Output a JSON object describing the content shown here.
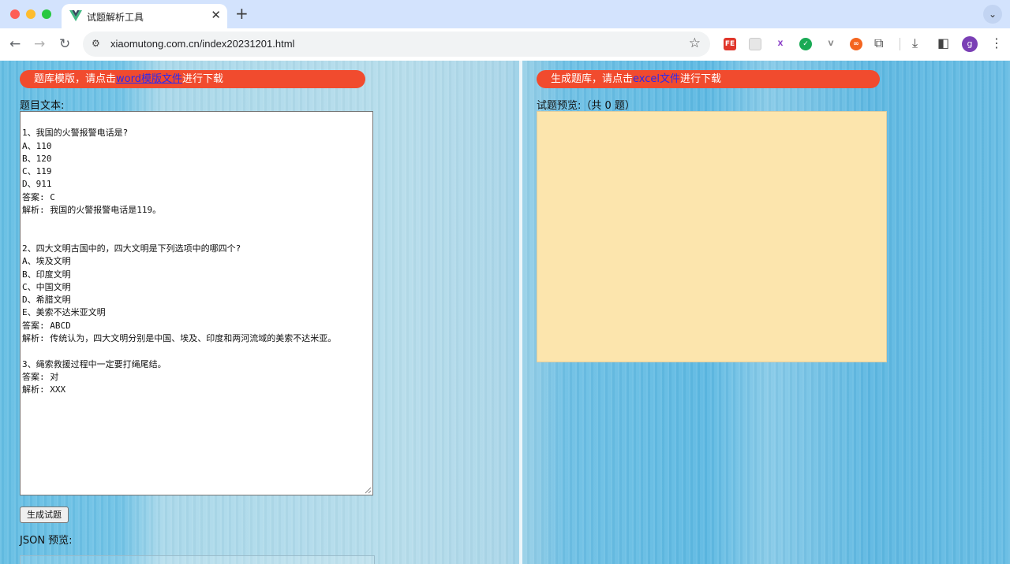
{
  "browser": {
    "tab_title": "试题解析工具",
    "tab_close": "✕",
    "new_tab": "+",
    "tab_menu": "⌄",
    "url": "xiaomutong.com.cn/index20231201.html",
    "profile_initial": "g",
    "extensions": [
      {
        "name": "fe-extension-icon",
        "label": "FE",
        "color": "#e0362b"
      },
      {
        "name": "blank-extension-icon",
        "label": "",
        "color": "#e6e6e6"
      },
      {
        "name": "x-extension-icon",
        "label": "X",
        "color": "#ffffff"
      },
      {
        "name": "check-extension-icon",
        "label": "✓",
        "color": "#1aaa55"
      },
      {
        "name": "vue-extension-icon",
        "label": "V",
        "color": "#ffffff"
      },
      {
        "name": "infinity-extension-icon",
        "label": "∞",
        "color": "#f4651f"
      }
    ]
  },
  "left": {
    "banner_prefix": "题库模版，请点击",
    "banner_link": "word模版文件",
    "banner_suffix": "进行下载",
    "text_label": "题目文本:",
    "question_text": "\n1、我国的火警报警电话是?\nA、110\nB、120\nC、119\nD、911\n答案: C\n解析: 我国的火警报警电话是119。\n\n\n2、四大文明古国中的，四大文明是下列选项中的哪四个?\nA、埃及文明\nB、印度文明\nC、中国文明\nD、希腊文明\nE、美索不达米亚文明\n答案: ABCD\n解析: 传统认为，四大文明分别是中国、埃及、印度和两河流域的美索不达米亚。\n\n3、绳索救援过程中一定要打绳尾结。\n答案: 对\n解析: XXX",
    "generate_button": "生成试题",
    "json_label": "JSON 预览:"
  },
  "right": {
    "banner_prefix": "生成题库，请点击",
    "banner_link": "excel文件",
    "banner_suffix": "进行下载",
    "preview_label": "试题预览:（共 0 题）"
  },
  "colors": {
    "banner": "#f14b2e",
    "link": "#2a2af0",
    "preview_bg": "#fce5ad"
  }
}
